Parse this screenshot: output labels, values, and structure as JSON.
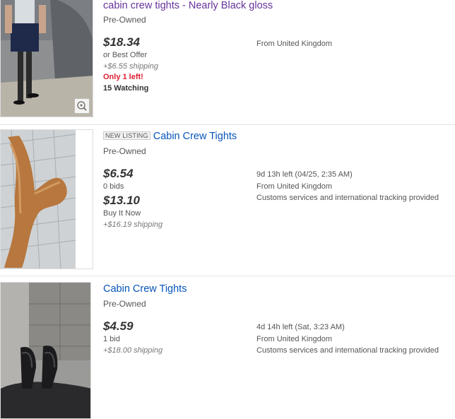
{
  "listings": [
    {
      "title": "cabin crew tights - Nearly Black gloss",
      "condition": "Pre-Owned",
      "price": "$18.34",
      "offer": "or Best Offer",
      "shipping": "+$6.55 shipping",
      "urgency": "Only 1 left!",
      "watching": "15 Watching",
      "location": "From United Kingdom"
    },
    {
      "badge": "NEW LISTING",
      "title": "Cabin Crew Tights",
      "condition": "Pre-Owned",
      "bid_price": "$6.54",
      "bids": "0 bids",
      "bin_price": "$13.10",
      "bin_label": "Buy It Now",
      "shipping": "+$16.19 shipping",
      "time_left": "9d 13h left (04/25, 2:35 AM)",
      "location": "From United Kingdom",
      "customs": "Customs services and international tracking provided"
    },
    {
      "title": "Cabin Crew Tights",
      "condition": "Pre-Owned",
      "price": "$4.59",
      "bids": "1 bid",
      "shipping": "+$18.00 shipping",
      "time_left": "4d 14h left (Sat, 3:23 AM)",
      "location": "From United Kingdom",
      "customs": "Customs services and international tracking provided"
    }
  ],
  "colors": {
    "link": "#0654ba",
    "visited_link": "#663399",
    "urgency": "#dd1e31"
  },
  "icons": {
    "zoom": "magnifier-plus-icon"
  }
}
